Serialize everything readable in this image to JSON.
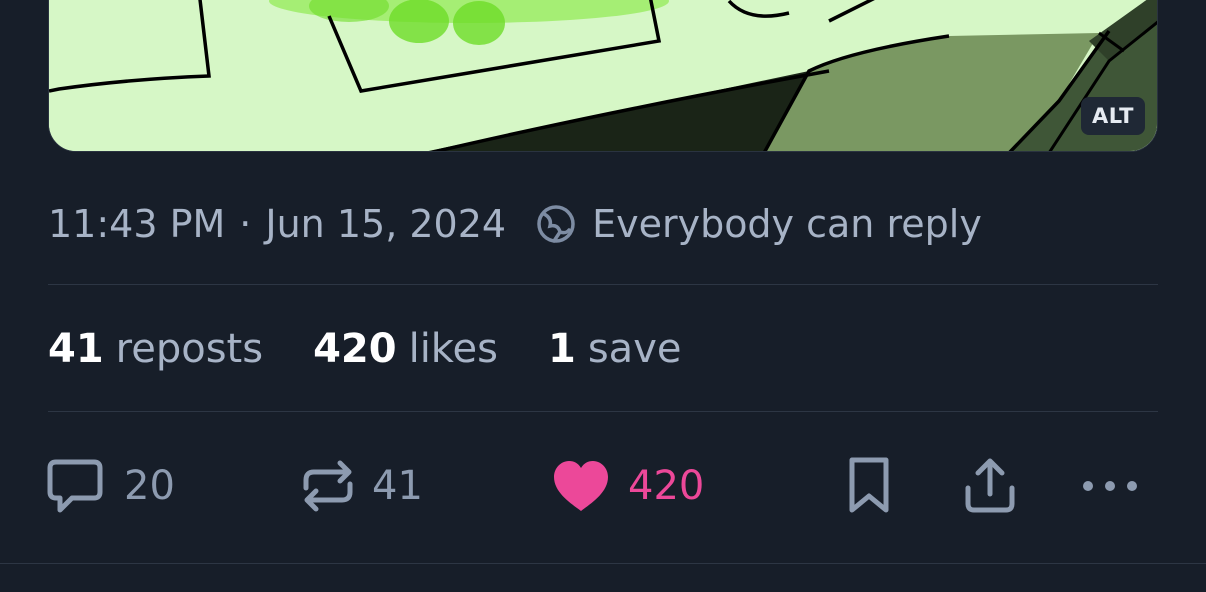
{
  "image": {
    "alt_badge": "ALT",
    "colors": {
      "background": "#d6f7c6",
      "neon_green": "#7ee832",
      "dark": "#1a2417",
      "olive": "#7a9862",
      "forest": "#3f5637",
      "outline": "#000000"
    }
  },
  "meta": {
    "time": "11:43 PM",
    "separator": "·",
    "date": "Jun 15, 2024",
    "reply_setting": "Everybody can reply",
    "reply_icon": "globe-icon"
  },
  "stats": {
    "reposts": {
      "count": "41",
      "label": "reposts"
    },
    "likes": {
      "count": "420",
      "label": "likes"
    },
    "saves": {
      "count": "1",
      "label": "save"
    }
  },
  "actions": {
    "reply": {
      "icon": "comment-icon",
      "count": "20"
    },
    "repost": {
      "icon": "repost-icon",
      "count": "41"
    },
    "like": {
      "icon": "heart-icon",
      "count": "420",
      "liked": true
    },
    "bookmark": {
      "icon": "bookmark-icon"
    },
    "share": {
      "icon": "share-icon"
    },
    "more": {
      "icon": "more-icon"
    }
  },
  "colors": {
    "background": "#171e29",
    "muted_text": "#a7b3c6",
    "icon": "#8d9bb0",
    "like": "#ec4899",
    "divider": "#2d3644"
  }
}
